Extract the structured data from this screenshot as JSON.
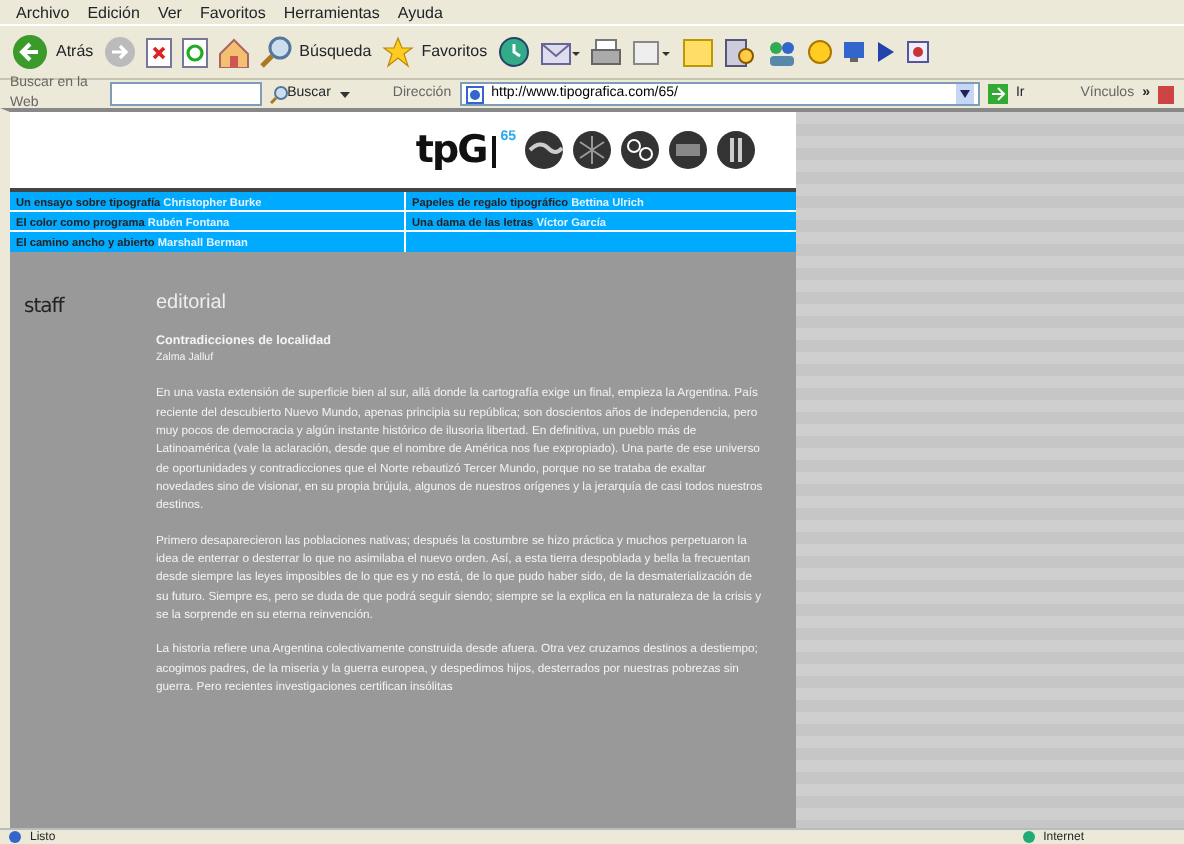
{
  "menu": [
    "Archivo",
    "Edición",
    "Ver",
    "Favoritos",
    "Herramientas",
    "Ayuda"
  ],
  "toolbar": {
    "back_label": "Atrás",
    "search_label": "Búsqueda",
    "favorites_label": "Favoritos"
  },
  "address_bar": {
    "search_web_label": "Buscar en la Web",
    "search_button": "Buscar",
    "address_label": "Dirección",
    "url": "http://www.tipografica.com/65/",
    "go_label": "Ir",
    "links_label": "Vínculos",
    "more": "»"
  },
  "page": {
    "logo": {
      "text": "tpG",
      "issue": "65"
    },
    "nav_links": [
      {
        "title": "Un ensayo sobre tipografía",
        "author": "Christopher Burke"
      },
      {
        "title": "Papeles de regalo tipográfico",
        "author": "Bettina Ulrich"
      },
      {
        "title": "El color como programa",
        "author": "Rubén Fontana"
      },
      {
        "title": "Una dama de las letras",
        "author": "Víctor García"
      },
      {
        "title": "El camino ancho y abierto",
        "author": "Marshall Berman"
      }
    ],
    "staff_label": "staff",
    "section_title": "editorial",
    "article": {
      "title": "Contradicciones de localidad",
      "author": "Zalma Jalluf",
      "paragraphs": [
        "En una vasta extensión de superficie bien al sur, allá donde la cartografía exige un final, empieza la Argentina. País reciente del descubierto Nuevo Mundo, apenas principia su república; son doscientos años de independencia, pero muy pocos de democracia y algún instante histórico de ilusoria libertad. En definitiva, un pueblo más de Latinoamérica (vale la aclaración, desde que el nombre de América nos fue expropiado). Una parte de ese universo de oportunidades y contradicciones que el Norte rebautizó Tercer Mundo, porque no se trataba de exaltar novedades sino de visionar, en su propia brújula, algunos de nuestros orígenes y la jerarquía de casi todos nuestros destinos.",
        "Primero desaparecieron las poblaciones nativas; después la costumbre se hizo práctica y muchos perpetuaron la idea de enterrar o desterrar lo que no asimilaba el nuevo orden. Así, a esta tierra despoblada y bella la frecuentan desde siempre las leyes imposibles de lo que es y no está, de lo que pudo haber sido, de la desmaterialización de su futuro. Siempre es, pero se duda de que podrá seguir siendo; siempre se la explica en la naturaleza de la crisis y se la sorprende en su eterna reinvención.",
        "La historia refiere una Argentina colectivamente construida desde afuera. Otra vez cruzamos destinos a destiempo; acogimos padres, de la miseria y la guerra europea, y despedimos hijos, desterrados por nuestras pobrezas sin guerra. Pero recientes investigaciones certifican insólitas"
      ]
    }
  },
  "status_bar": {
    "status": "Listo",
    "zone": "Internet"
  }
}
